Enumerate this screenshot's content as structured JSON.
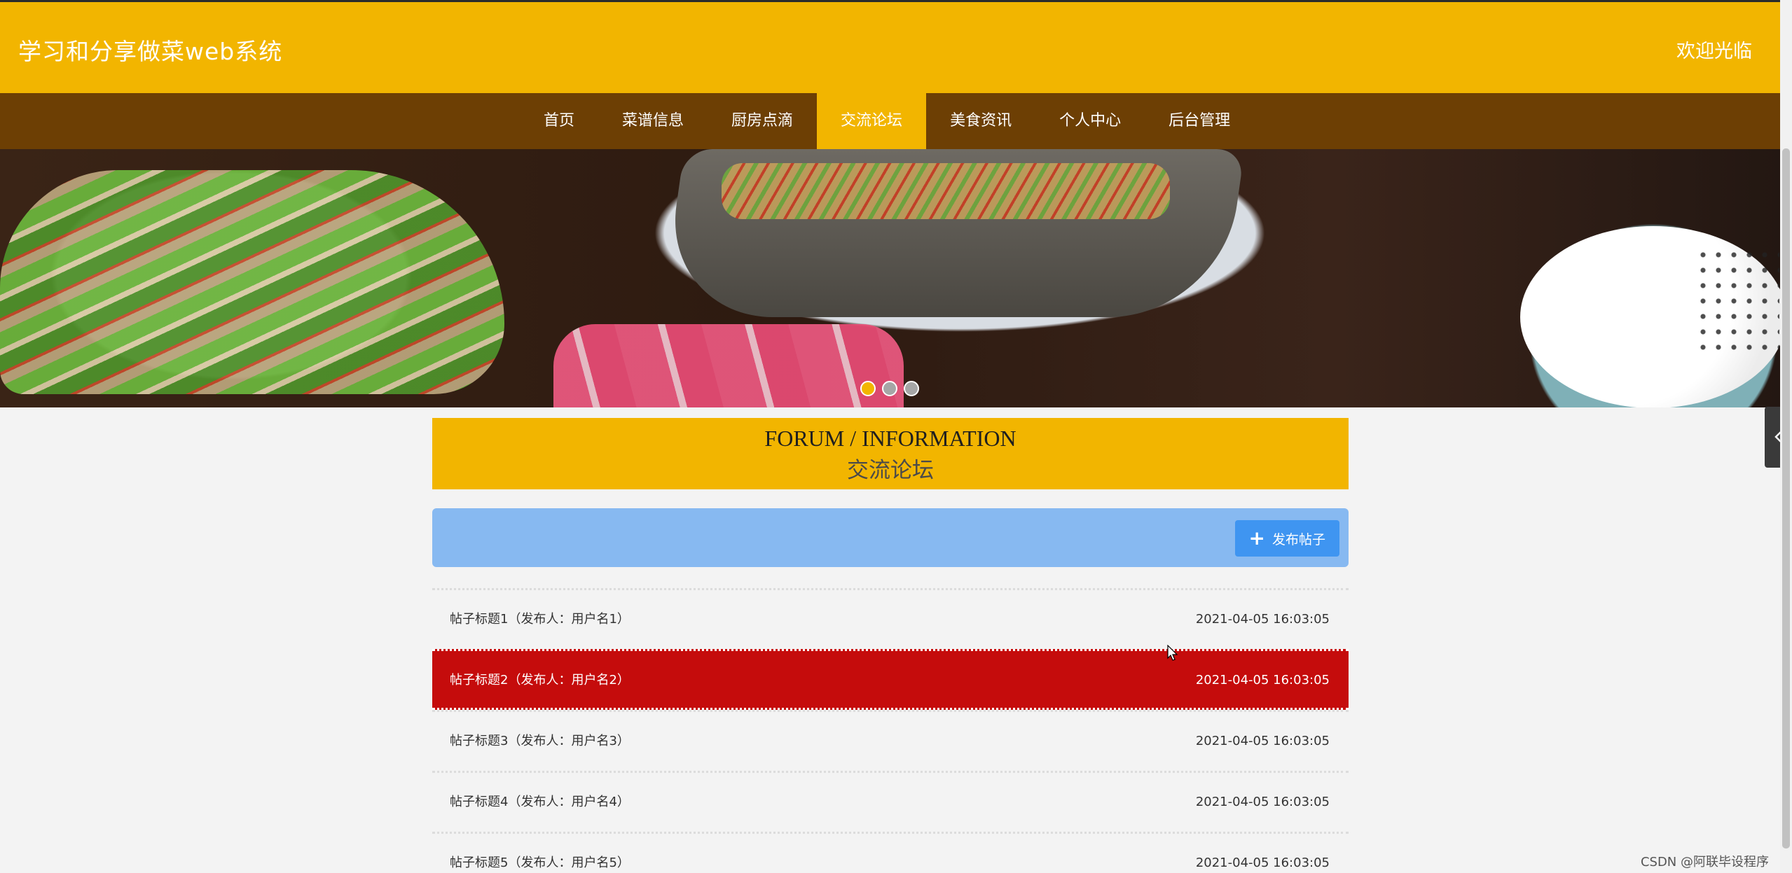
{
  "header": {
    "site_title": "学习和分享做菜web系统",
    "welcome": "欢迎光临"
  },
  "nav": {
    "items": [
      {
        "label": "首页"
      },
      {
        "label": "菜谱信息"
      },
      {
        "label": "厨房点滴"
      },
      {
        "label": "交流论坛",
        "active": true
      },
      {
        "label": "美食资讯"
      },
      {
        "label": "个人中心"
      },
      {
        "label": "后台管理"
      }
    ]
  },
  "banner": {
    "slide_count": 3,
    "active_slide": 1
  },
  "section": {
    "title_en": "FORUM / INFORMATION",
    "title_zh": "交流论坛"
  },
  "toolbar": {
    "post_button_label": "发布帖子",
    "post_button_icon": "plus-icon"
  },
  "posts": [
    {
      "title": "帖子标题1（发布人：用户名1）",
      "time": "2021-04-05 16:03:05"
    },
    {
      "title": "帖子标题2（发布人：用户名2）",
      "time": "2021-04-05 16:03:05",
      "highlight": true
    },
    {
      "title": "帖子标题3（发布人：用户名3）",
      "time": "2021-04-05 16:03:05"
    },
    {
      "title": "帖子标题4（发布人：用户名4）",
      "time": "2021-04-05 16:03:05"
    },
    {
      "title": "帖子标题5（发布人：用户名5）",
      "time": "2021-04-05 16:03:05"
    }
  ],
  "watermark": "CSDN @阿联毕设程序",
  "colors": {
    "header_bg": "#f2b500",
    "nav_bg": "#6d3f04",
    "toolbar_bg": "#87b9f1",
    "button_bg": "#3f95f1",
    "highlight_row": "#c50c0c"
  }
}
